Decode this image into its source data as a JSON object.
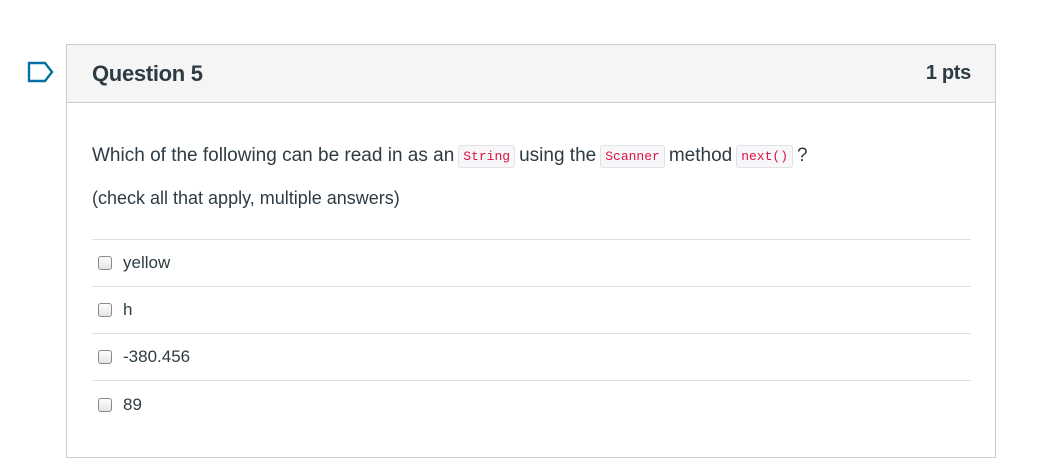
{
  "question": {
    "title": "Question 5",
    "points": "1 pts",
    "text_parts": {
      "p1": "Which of the following can be read in as an",
      "code1": "String",
      "p2": "using the",
      "code2": "Scanner",
      "p3": "method",
      "code3": "next()",
      "p4": "?"
    },
    "hint": "(check all that apply, multiple answers)",
    "answers": [
      {
        "label": "yellow",
        "checked": false
      },
      {
        "label": "h",
        "checked": false
      },
      {
        "label": "-380.456",
        "checked": false
      },
      {
        "label": "89",
        "checked": false
      }
    ]
  },
  "icons": {
    "flag": "flag-icon"
  },
  "colors": {
    "flag_outline": "#0770a3",
    "code_text": "#dd1144",
    "header_bg": "#f5f5f5",
    "border": "#c7cdd1"
  }
}
